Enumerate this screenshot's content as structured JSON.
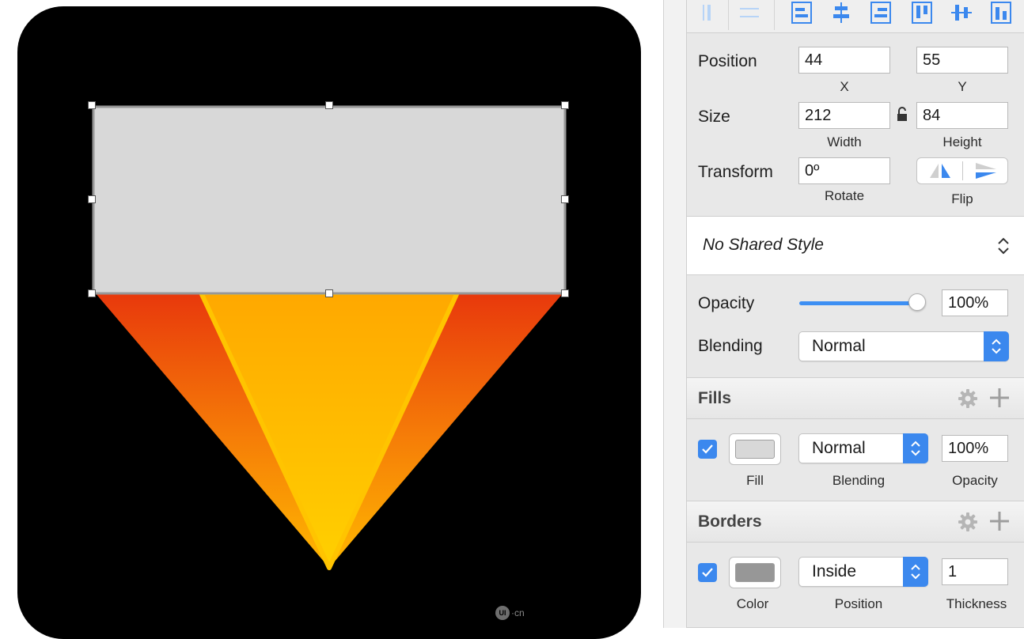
{
  "canvas": {
    "watermark_text": "·cn",
    "watermark_logo": "UI",
    "colors": {
      "artboard": "#000000",
      "selected_rect_fill": "#d8d8d8",
      "selected_rect_border": "#979797",
      "outer_triangle_top": "#e8380c",
      "outer_triangle_bottom": "#ffb800",
      "inner_triangle_top": "#ffaa00",
      "inner_triangle_bottom": "#ffd000"
    }
  },
  "inspector": {
    "align_icons": [
      "align-left-edge-icon",
      "align-horizontal-center-icon",
      "align-left-icon",
      "align-center-icon",
      "align-right-icon",
      "align-top-icon",
      "align-middle-icon",
      "align-bottom-icon"
    ],
    "position": {
      "label": "Position",
      "x": "44",
      "y": "55",
      "x_caption": "X",
      "y_caption": "Y"
    },
    "size": {
      "label": "Size",
      "width": "212",
      "height": "84",
      "width_caption": "Width",
      "height_caption": "Height"
    },
    "transform": {
      "label": "Transform",
      "rotate": "0º",
      "rotate_caption": "Rotate",
      "flip_caption": "Flip"
    },
    "shared_style": "No Shared Style",
    "opacity": {
      "label": "Opacity",
      "value": "100%",
      "level": 1.0
    },
    "blending": {
      "label": "Blending",
      "value": "Normal"
    },
    "fills": {
      "title": "Fills",
      "enabled": true,
      "color": "#d8d8d8",
      "blending": "Normal",
      "opacity": "100%",
      "captions": {
        "fill": "Fill",
        "blending": "Blending",
        "opacity": "Opacity"
      }
    },
    "borders": {
      "title": "Borders",
      "enabled": true,
      "color": "#979797",
      "position": "Inside",
      "thickness": "1",
      "captions": {
        "color": "Color",
        "position": "Position",
        "thickness": "Thickness"
      }
    },
    "accent": "#3b88ee"
  }
}
